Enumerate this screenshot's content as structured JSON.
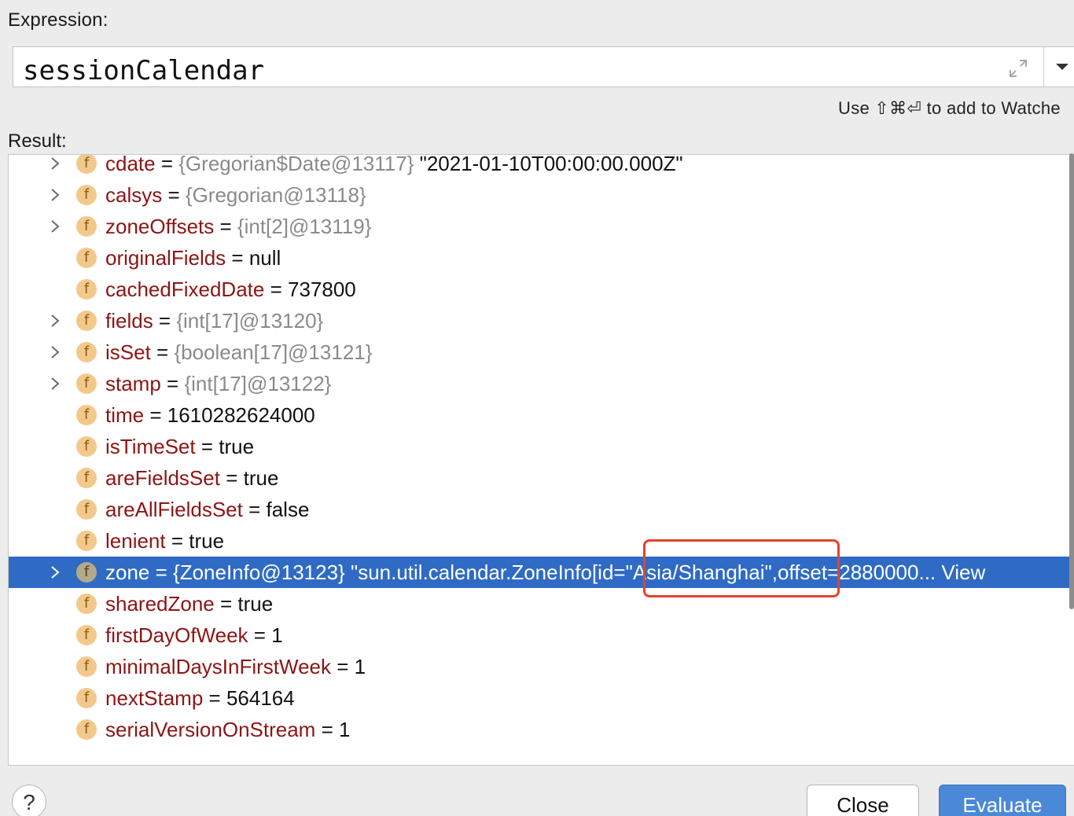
{
  "labels": {
    "expression": "Expression:",
    "result": "Result:"
  },
  "expression": {
    "value": "sessionCalendar"
  },
  "hint": "Use ⇧⌘⏎ to add to Watche",
  "rows": [
    {
      "name": "cdate",
      "eq": " = ",
      "ref": "{Gregorian$Date@13117}",
      "val": " \"2021-01-10T00:00:00.000Z\"",
      "expandable": true
    },
    {
      "name": "calsys",
      "eq": " = ",
      "ref": "{Gregorian@13118}",
      "val": "",
      "expandable": true
    },
    {
      "name": "zoneOffsets",
      "eq": " = ",
      "ref": "{int[2]@13119}",
      "val": "",
      "expandable": true
    },
    {
      "name": "originalFields",
      "eq": " = ",
      "ref": "",
      "val": "null",
      "expandable": false
    },
    {
      "name": "cachedFixedDate",
      "eq": " = ",
      "ref": "",
      "val": "737800",
      "expandable": false
    },
    {
      "name": "fields",
      "eq": " = ",
      "ref": "{int[17]@13120}",
      "val": "",
      "expandable": true
    },
    {
      "name": "isSet",
      "eq": " = ",
      "ref": "{boolean[17]@13121}",
      "val": "",
      "expandable": true
    },
    {
      "name": "stamp",
      "eq": " = ",
      "ref": "{int[17]@13122}",
      "val": "",
      "expandable": true
    },
    {
      "name": "time",
      "eq": " = ",
      "ref": "",
      "val": "1610282624000",
      "expandable": false
    },
    {
      "name": "isTimeSet",
      "eq": " = ",
      "ref": "",
      "val": "true",
      "expandable": false
    },
    {
      "name": "areFieldsSet",
      "eq": " = ",
      "ref": "",
      "val": "true",
      "expandable": false
    },
    {
      "name": "areAllFieldsSet",
      "eq": " = ",
      "ref": "",
      "val": "false",
      "expandable": false
    },
    {
      "name": "lenient",
      "eq": " = ",
      "ref": "",
      "val": "true",
      "expandable": false
    },
    {
      "name": "zone",
      "eq": " = ",
      "ref": "{ZoneInfo@13123}",
      "val": " \"sun.util.calendar.ZoneInfo[id=\"Asia/Shanghai\",offset=2880000... View",
      "expandable": true,
      "selected": true
    },
    {
      "name": "sharedZone",
      "eq": " = ",
      "ref": "",
      "val": "true",
      "expandable": false
    },
    {
      "name": "firstDayOfWeek",
      "eq": " = ",
      "ref": "",
      "val": "1",
      "expandable": false
    },
    {
      "name": "minimalDaysInFirstWeek",
      "eq": " = ",
      "ref": "",
      "val": "1",
      "expandable": false
    },
    {
      "name": "nextStamp",
      "eq": " = ",
      "ref": "",
      "val": "564164",
      "expandable": false
    },
    {
      "name": "serialVersionOnStream",
      "eq": " = ",
      "ref": "",
      "val": "1",
      "expandable": false
    }
  ],
  "badge_letter": "f",
  "buttons": {
    "help": "?",
    "close": "Close",
    "evaluate": "Evaluate"
  },
  "colors": {
    "selection": "#2f6bc5",
    "field_name": "#8c1515",
    "highlight_box": "#e6412f",
    "evaluate_button": "#4a89d8"
  },
  "icons": [
    "expand-icon",
    "dropdown-arrow-icon",
    "chevron-right-icon",
    "field-badge-icon",
    "help-icon"
  ]
}
